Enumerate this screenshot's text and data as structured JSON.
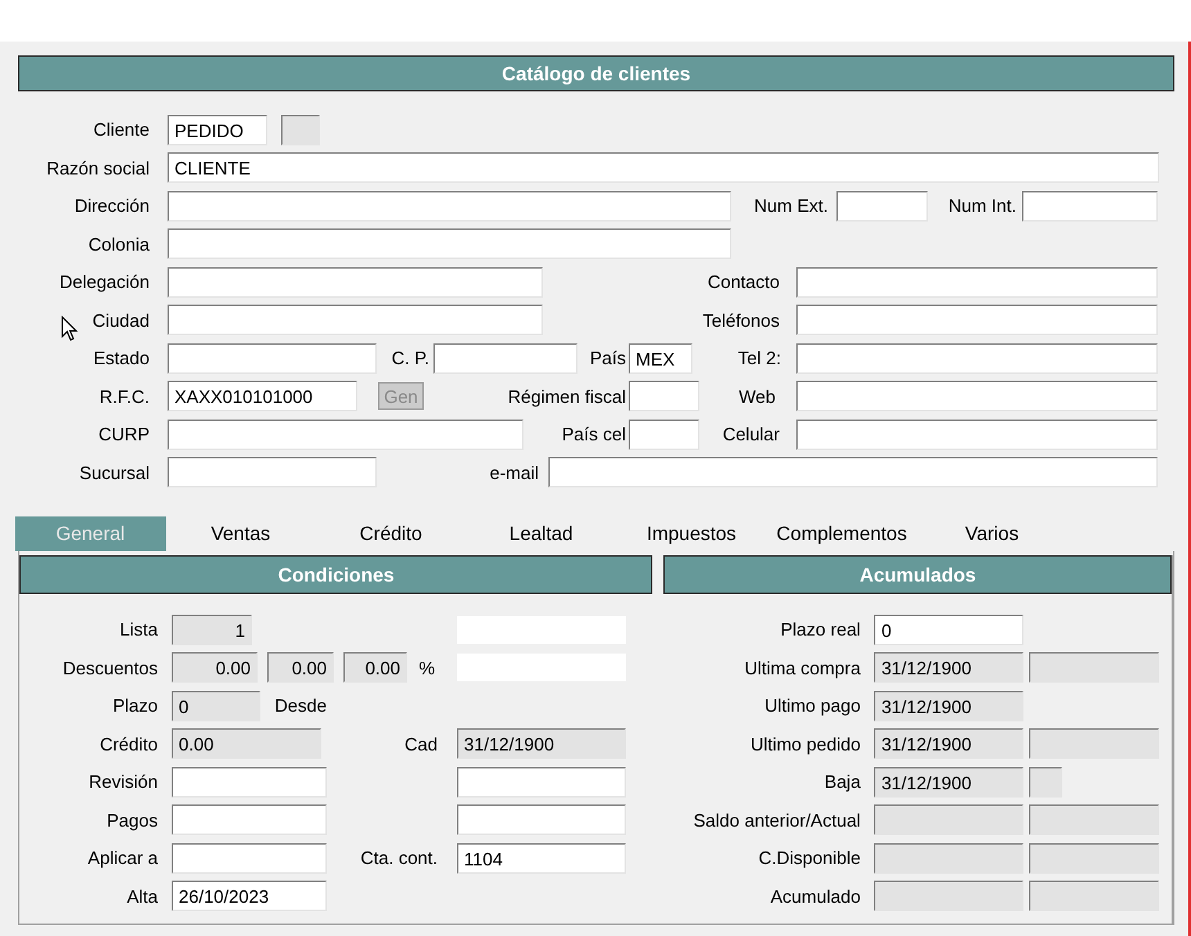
{
  "title": "Catálogo de clientes",
  "form_rows": [
    {
      "items": [
        {
          "kind": "label",
          "text": "Cliente"
        },
        {
          "kind": "field",
          "value": "PEDIDO",
          "disabled": false
        },
        {
          "kind": "field",
          "disabled": true
        }
      ]
    },
    {
      "items": [
        {
          "kind": "label",
          "text": "Razón social"
        },
        {
          "kind": "field",
          "value": "CLIENTE",
          "disabled": false
        }
      ]
    },
    {
      "items": [
        {
          "kind": "label",
          "text": "Dirección"
        },
        {
          "kind": "field",
          "disabled": false
        },
        {
          "kind": "label",
          "text": "Num Ext."
        },
        {
          "kind": "field",
          "disabled": false
        },
        {
          "kind": "label",
          "text": "Num Int."
        },
        {
          "kind": "field",
          "disabled": false
        }
      ]
    },
    {
      "items": [
        {
          "kind": "label",
          "text": "Colonia"
        },
        {
          "kind": "field",
          "disabled": false
        }
      ]
    },
    {
      "items": [
        {
          "kind": "label",
          "text": "Delegación"
        },
        {
          "kind": "field",
          "disabled": false
        },
        {
          "kind": "label",
          "text": "Contacto"
        },
        {
          "kind": "field",
          "disabled": false
        }
      ]
    },
    {
      "items": [
        {
          "kind": "label",
          "text": "Ciudad"
        },
        {
          "kind": "field",
          "disabled": false
        },
        {
          "kind": "label",
          "text": "Teléfonos"
        },
        {
          "kind": "field",
          "disabled": false
        }
      ]
    },
    {
      "items": [
        {
          "kind": "label",
          "text": "Estado"
        },
        {
          "kind": "field",
          "disabled": false
        },
        {
          "kind": "label",
          "text": "C. P."
        },
        {
          "kind": "field",
          "disabled": false
        },
        {
          "kind": "label",
          "text": "País"
        },
        {
          "kind": "field",
          "value": "MEX",
          "disabled": false
        },
        {
          "kind": "label",
          "text": "Tel 2:"
        },
        {
          "kind": "field",
          "disabled": false
        }
      ]
    },
    {
      "items": [
        {
          "kind": "label",
          "text": "R.F.C."
        },
        {
          "kind": "field",
          "value": "XAXX010101000",
          "disabled": false
        },
        {
          "kind": "button",
          "text": "Gen",
          "disabled": true
        },
        {
          "kind": "label",
          "text": "Régimen fiscal"
        },
        {
          "kind": "field",
          "disabled": false
        },
        {
          "kind": "label",
          "text": "Web"
        },
        {
          "kind": "field",
          "disabled": false
        }
      ]
    },
    {
      "items": [
        {
          "kind": "label",
          "text": "CURP"
        },
        {
          "kind": "field",
          "disabled": false
        },
        {
          "kind": "label",
          "text": "País cel"
        },
        {
          "kind": "field",
          "disabled": false
        },
        {
          "kind": "label",
          "text": "Celular"
        },
        {
          "kind": "field",
          "disabled": false
        }
      ]
    },
    {
      "items": [
        {
          "kind": "label",
          "text": "Sucursal"
        },
        {
          "kind": "field",
          "disabled": false
        },
        {
          "kind": "label",
          "text": "e-mail"
        },
        {
          "kind": "field",
          "disabled": false
        }
      ]
    }
  ],
  "tabs": [
    {
      "label": "General",
      "selected": true
    },
    {
      "label": "Ventas",
      "selected": false
    },
    {
      "label": "Crédito",
      "selected": false
    },
    {
      "label": "Lealtad",
      "selected": false
    },
    {
      "label": "Impuestos",
      "selected": false
    },
    {
      "label": "Complementos",
      "selected": false
    },
    {
      "label": "Varios",
      "selected": false
    }
  ],
  "conditions": {
    "title": "Condiciones",
    "rows": [
      {
        "items": [
          {
            "kind": "label",
            "text": "Lista"
          },
          {
            "kind": "number-field",
            "value": "1",
            "disabled": true
          },
          {
            "kind": "box"
          }
        ]
      },
      {
        "items": [
          {
            "kind": "label",
            "text": "Descuentos"
          },
          {
            "kind": "number-field",
            "value": "0.00",
            "disabled": true
          },
          {
            "kind": "number-field",
            "value": "0.00",
            "disabled": true
          },
          {
            "kind": "number-field",
            "value": "0.00",
            "disabled": true
          },
          {
            "kind": "label",
            "text": "%"
          },
          {
            "kind": "box"
          }
        ]
      },
      {
        "items": [
          {
            "kind": "label",
            "text": "Plazo"
          },
          {
            "kind": "field",
            "value": "0",
            "disabled": true
          },
          {
            "kind": "label",
            "text": "Desde"
          }
        ]
      },
      {
        "items": [
          {
            "kind": "label",
            "text": "Crédito"
          },
          {
            "kind": "field",
            "value": "0.00",
            "disabled": true
          },
          {
            "kind": "label",
            "text": "Cad"
          },
          {
            "kind": "field",
            "value": "31/12/1900",
            "disabled": true
          }
        ]
      },
      {
        "items": [
          {
            "kind": "label",
            "text": "Revisión"
          },
          {
            "kind": "field",
            "disabled": false
          },
          {
            "kind": "field",
            "disabled": false
          }
        ]
      },
      {
        "items": [
          {
            "kind": "label",
            "text": "Pagos"
          },
          {
            "kind": "field",
            "disabled": false
          },
          {
            "kind": "field",
            "disabled": false
          }
        ]
      },
      {
        "items": [
          {
            "kind": "label",
            "text": "Aplicar a"
          },
          {
            "kind": "field",
            "disabled": false
          },
          {
            "kind": "label",
            "text": "Cta. cont."
          },
          {
            "kind": "field",
            "value": "1104",
            "disabled": false
          }
        ]
      },
      {
        "items": [
          {
            "kind": "label",
            "text": "Alta"
          },
          {
            "kind": "field",
            "value": "26/10/2023",
            "disabled": false
          }
        ]
      }
    ]
  },
  "accumulated": {
    "title": "Acumulados",
    "rows": [
      {
        "items": [
          {
            "kind": "label",
            "text": "Plazo real"
          },
          {
            "kind": "field",
            "value": "0",
            "disabled": false
          }
        ]
      },
      {
        "items": [
          {
            "kind": "label",
            "text": "Ultima compra"
          },
          {
            "kind": "field",
            "value": "31/12/1900",
            "disabled": true
          },
          {
            "kind": "field",
            "disabled": true
          }
        ]
      },
      {
        "items": [
          {
            "kind": "label",
            "text": "Ultimo pago"
          },
          {
            "kind": "field",
            "value": "31/12/1900",
            "disabled": true
          }
        ]
      },
      {
        "items": [
          {
            "kind": "label",
            "text": "Ultimo pedido"
          },
          {
            "kind": "field",
            "value": "31/12/1900",
            "disabled": true
          },
          {
            "kind": "field",
            "disabled": true
          }
        ]
      },
      {
        "items": [
          {
            "kind": "label",
            "text": "Baja"
          },
          {
            "kind": "field",
            "value": "31/12/1900",
            "disabled": true
          },
          {
            "kind": "field",
            "disabled": true
          }
        ]
      },
      {
        "items": [
          {
            "kind": "label",
            "text": "Saldo anterior/Actual"
          },
          {
            "kind": "field",
            "disabled": true
          },
          {
            "kind": "field",
            "disabled": true
          }
        ]
      },
      {
        "items": [
          {
            "kind": "label",
            "text": "C.Disponible"
          },
          {
            "kind": "field",
            "disabled": true
          },
          {
            "kind": "field",
            "disabled": true
          }
        ]
      },
      {
        "items": [
          {
            "kind": "label",
            "text": "Acumulado"
          },
          {
            "kind": "field",
            "disabled": true
          },
          {
            "kind": "field",
            "disabled": true
          }
        ]
      }
    ]
  }
}
